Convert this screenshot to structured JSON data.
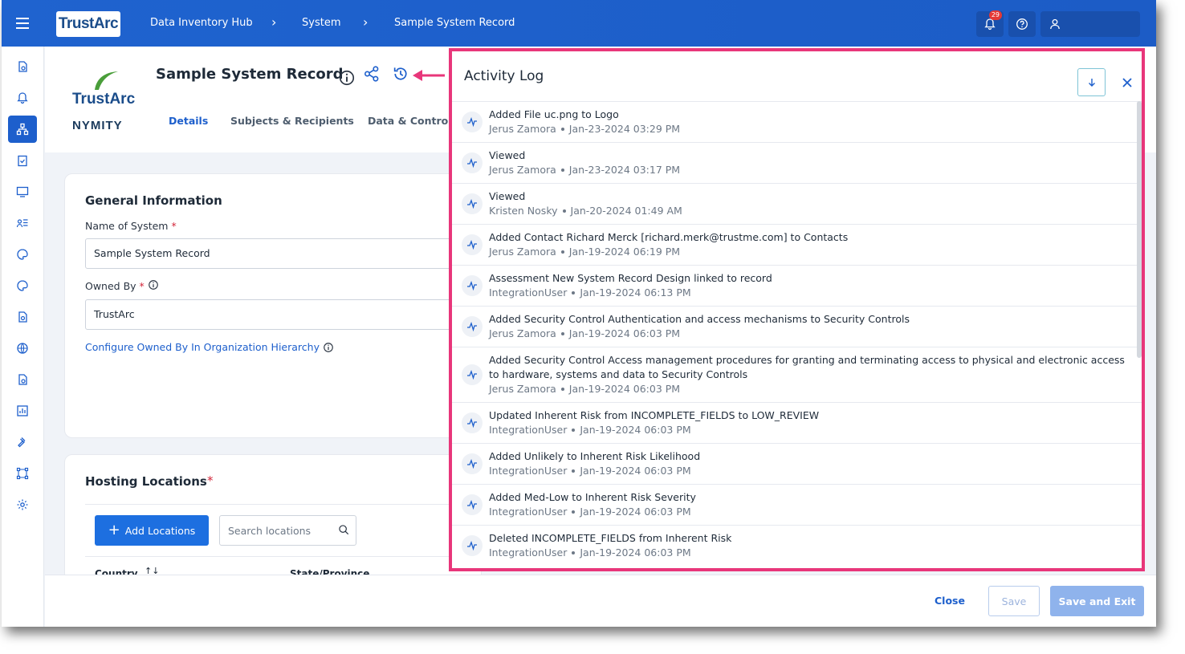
{
  "topbar": {
    "logo_text": "TrustArc",
    "breadcrumbs": [
      "Data Inventory Hub",
      "System",
      "Sample System Record"
    ],
    "notifications_count": "29"
  },
  "header": {
    "brand_word": "TrustArc",
    "brand_sub": "NYMITY",
    "title": "Sample System Record",
    "tabs": [
      {
        "label": "Details",
        "active": true
      },
      {
        "label": "Subjects & Recipients",
        "active": false
      },
      {
        "label": "Data & Controls",
        "active": false
      }
    ]
  },
  "general": {
    "title": "General Information",
    "name_label": "Name of System",
    "name_value": "Sample System Record",
    "owned_label": "Owned By",
    "owned_value": "TrustArc",
    "configure_link": "Configure Owned By In Organization Hierarchy"
  },
  "hosting": {
    "title": "Hosting Locations",
    "add_button": "Add Locations",
    "search_placeholder": "Search locations",
    "columns": [
      "Country",
      "State/Province"
    ]
  },
  "footer": {
    "close": "Close",
    "save": "Save",
    "save_exit": "Save and Exit"
  },
  "activity_log": {
    "title": "Activity Log",
    "items": [
      {
        "action": "Added File uc.png to Logo",
        "user": "Jerus Zamora",
        "time": "Jan-23-2024 03:29 PM"
      },
      {
        "action": "Viewed",
        "user": "Jerus Zamora",
        "time": "Jan-23-2024 03:17 PM"
      },
      {
        "action": "Viewed",
        "user": "Kristen Nosky",
        "time": "Jan-20-2024 01:49 AM"
      },
      {
        "action": "Added Contact Richard Merck [richard.merk@trustme.com] to Contacts",
        "user": "Jerus Zamora",
        "time": "Jan-19-2024 06:19 PM"
      },
      {
        "action": "Assessment New System Record Design linked to record",
        "user": "IntegrationUser",
        "time": "Jan-19-2024 06:13 PM"
      },
      {
        "action": "Added Security Control Authentication and access mechanisms to Security Controls",
        "user": "Jerus Zamora",
        "time": "Jan-19-2024 06:03 PM"
      },
      {
        "action": "Added Security Control Access management procedures for granting and terminating access to physical and electronic access to hardware, systems and data to Security Controls",
        "user": "Jerus Zamora",
        "time": "Jan-19-2024 06:03 PM"
      },
      {
        "action": "Updated Inherent Risk from INCOMPLETE_FIELDS to LOW_REVIEW",
        "user": "IntegrationUser",
        "time": "Jan-19-2024 06:03 PM"
      },
      {
        "action": "Added Unlikely to Inherent Risk Likelihood",
        "user": "IntegrationUser",
        "time": "Jan-19-2024 06:03 PM"
      },
      {
        "action": "Added Med-Low to Inherent Risk Severity",
        "user": "IntegrationUser",
        "time": "Jan-19-2024 06:03 PM"
      },
      {
        "action": "Deleted INCOMPLETE_FIELDS from Inherent Risk",
        "user": "IntegrationUser",
        "time": "Jan-19-2024 06:03 PM"
      }
    ]
  },
  "colors": {
    "brand_blue": "#1d5fcc",
    "highlight_pink": "#e8367a"
  }
}
